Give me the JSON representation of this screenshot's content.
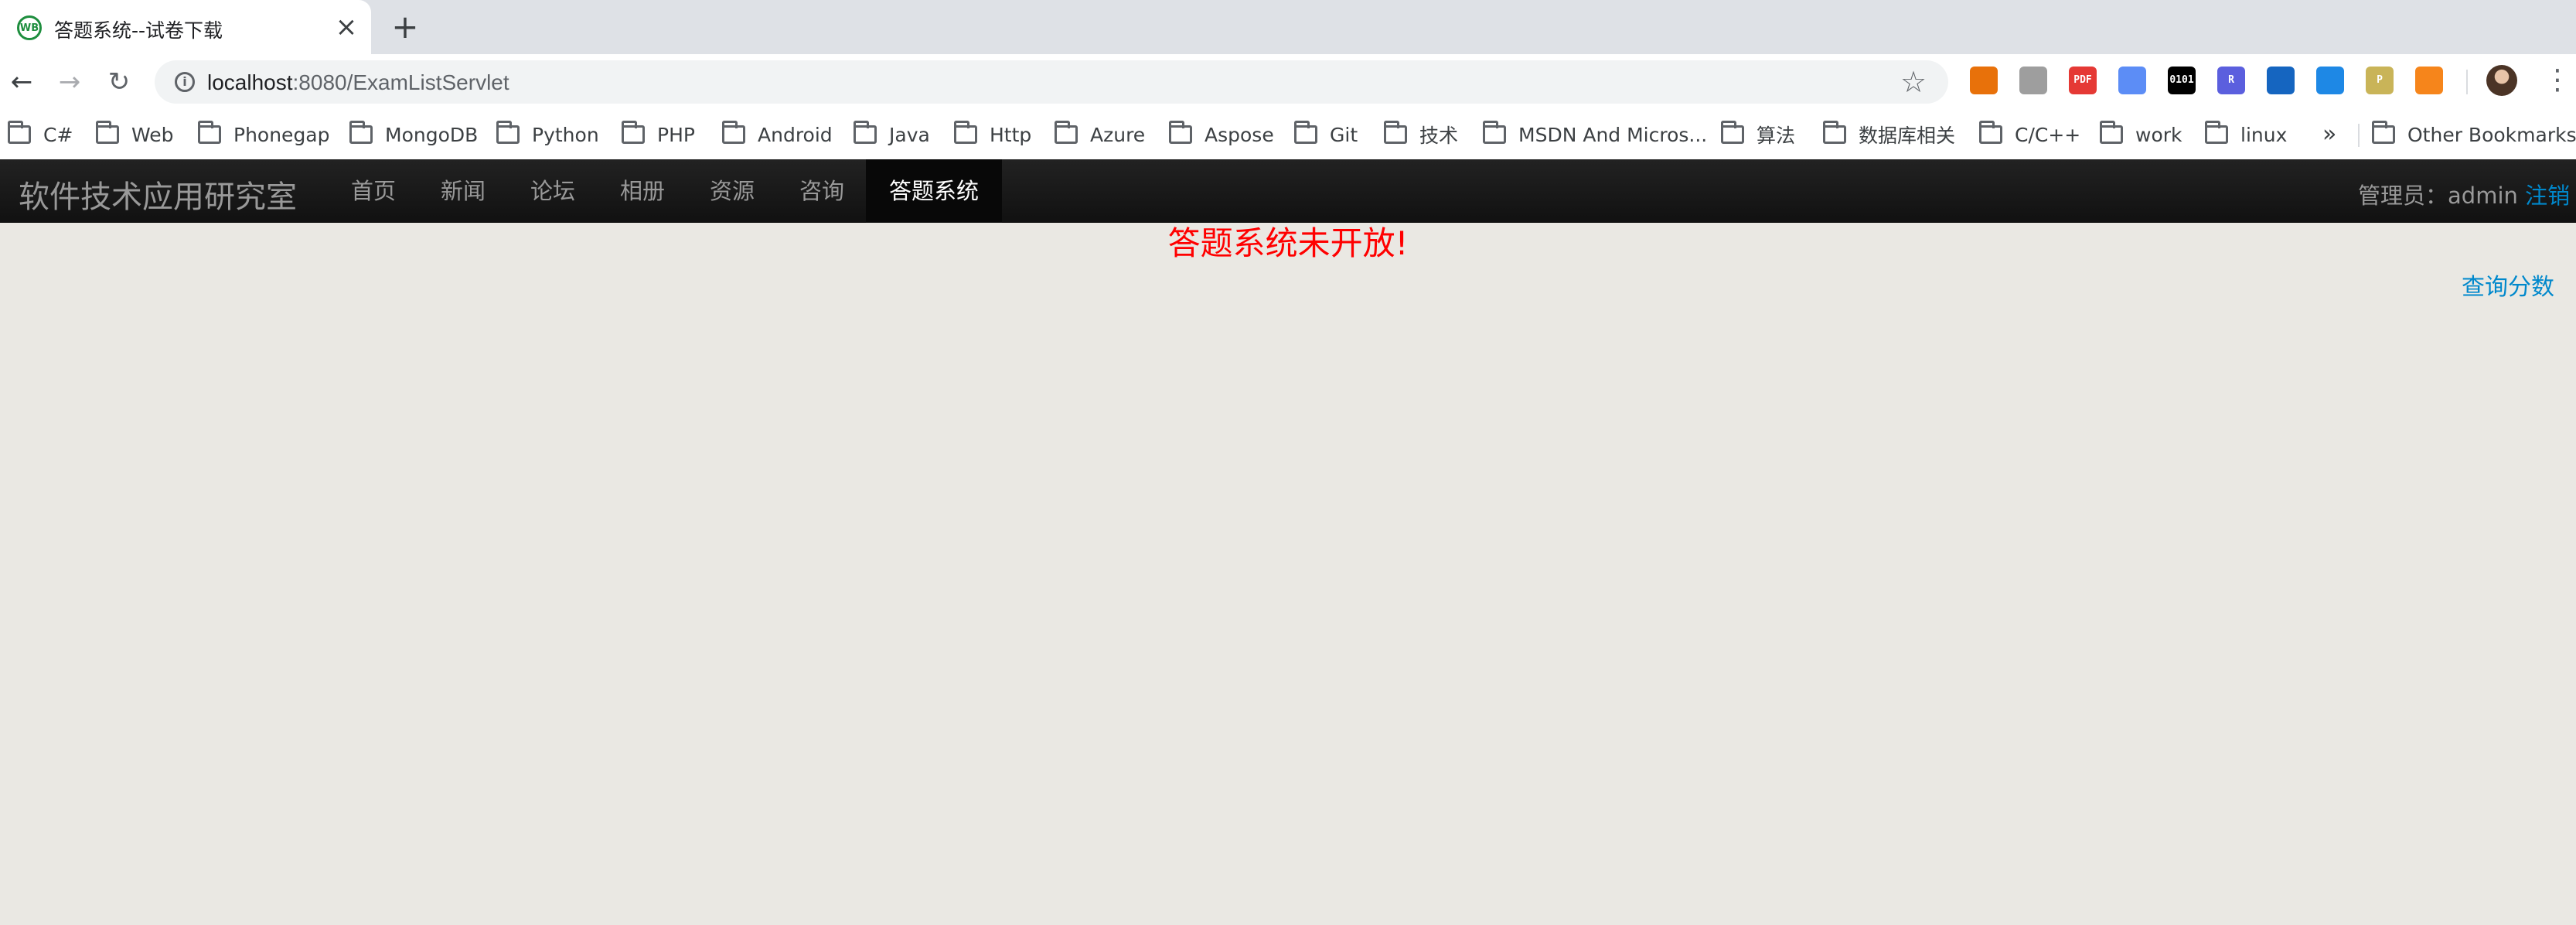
{
  "browser": {
    "tab_title": "答题系统--试卷下载",
    "tab_favicon_text": "WB",
    "url_host": "localhost",
    "url_rest": ":8080/ExamListServlet",
    "extensions": [
      {
        "name": "extension-icon-1",
        "color": "#e8710a",
        "text": ""
      },
      {
        "name": "extension-icon-2",
        "color": "#9e9e9e",
        "text": ""
      },
      {
        "name": "pdf-extension-icon",
        "color": "#e53935",
        "text": "PDF"
      },
      {
        "name": "extension-icon-4",
        "color": "#5c8df6",
        "text": ""
      },
      {
        "name": "binary-extension-icon",
        "color": "#000000",
        "text": "0101"
      },
      {
        "name": "extension-icon-6",
        "color": "#5b5fde",
        "text": "R"
      },
      {
        "name": "extension-icon-7",
        "color": "#1565c0",
        "text": ""
      },
      {
        "name": "extension-icon-8",
        "color": "#1e88e5",
        "text": ""
      },
      {
        "name": "extension-icon-9",
        "color": "#c9b458",
        "text": "P"
      },
      {
        "name": "metamask-extension-icon",
        "color": "#f6851b",
        "text": ""
      }
    ]
  },
  "bookmarks": {
    "items": [
      "C#",
      "Web",
      "Phonegap",
      "MongoDB",
      "Python",
      "PHP",
      "Android",
      "Java",
      "Http",
      "Azure",
      "Aspose",
      "Git",
      "技术",
      "MSDN And Micros...",
      "算法",
      "数据库相关",
      "C/C++",
      "work",
      "linux"
    ],
    "more": "»",
    "other": "Other Bookmarks"
  },
  "navbar": {
    "brand": "软件技术应用研究室",
    "items": [
      "首页",
      "新闻",
      "论坛",
      "相册",
      "资源",
      "咨询",
      "答题系统"
    ],
    "active_index": 6,
    "admin_label": "管理员：",
    "admin_name": "admin",
    "logout": "注销"
  },
  "content": {
    "message": "答题系统未开放!",
    "score_link": "查询分数"
  },
  "colors": {
    "message": "#ff0000",
    "link": "#0088cc",
    "navbar": "#1b1b1b",
    "page_bg": "#eae8e3"
  }
}
